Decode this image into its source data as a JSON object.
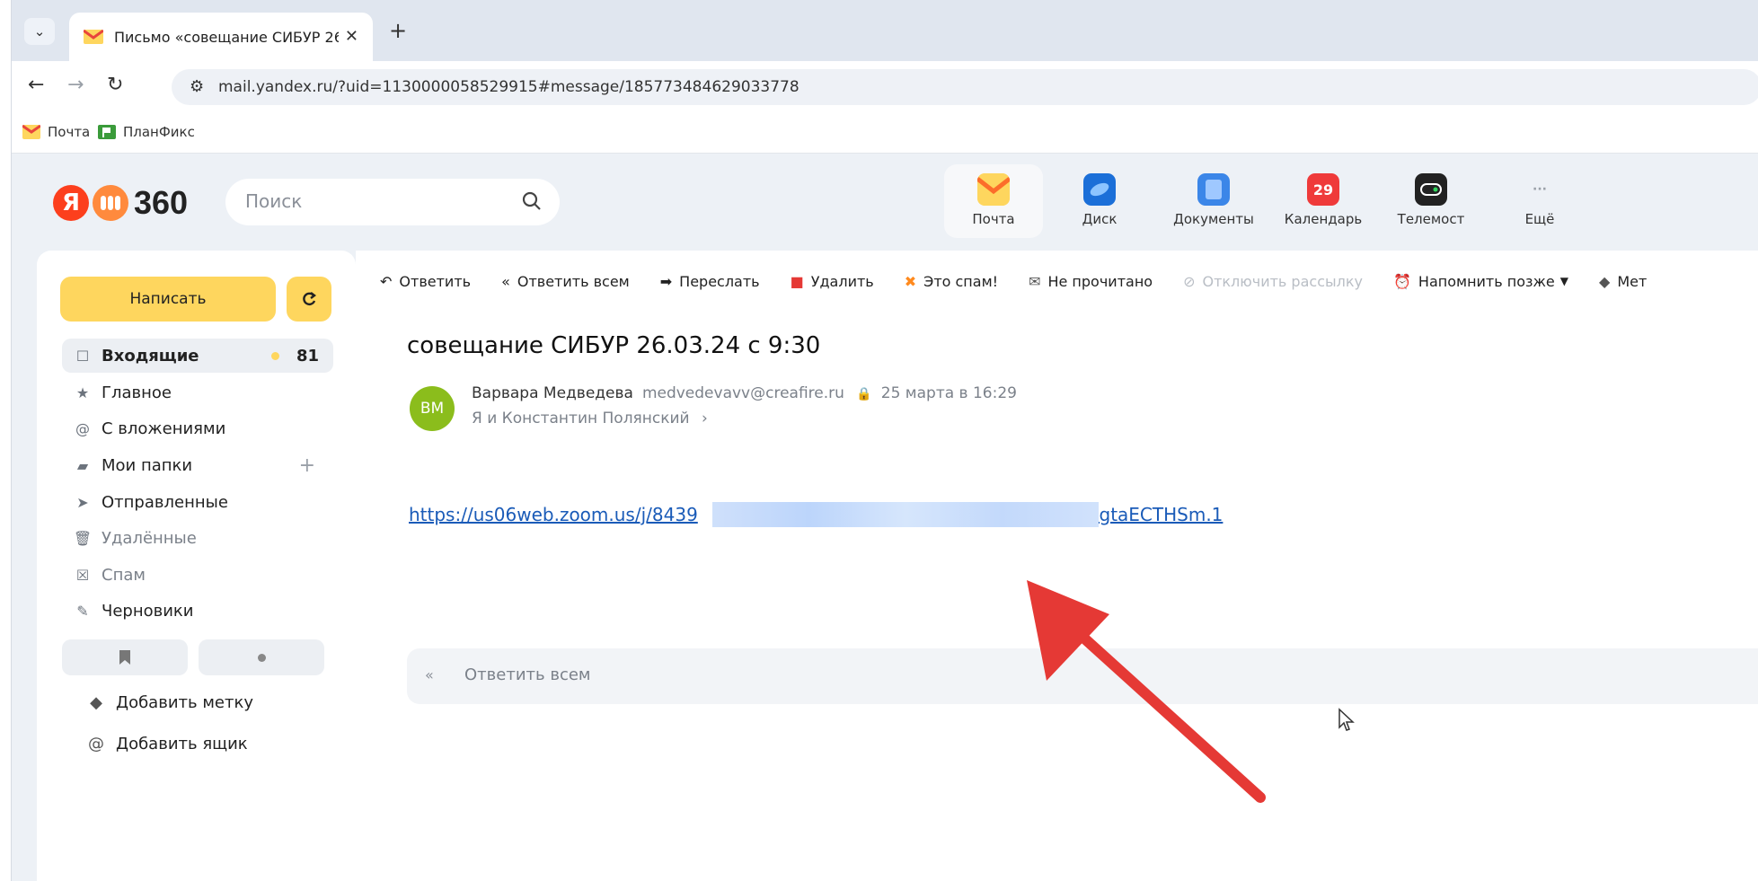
{
  "browser": {
    "tab_title": "Письмо «совещание СИБУР 26",
    "url": "mail.yandex.ru/?uid=1130000058529915#message/185773484629033778",
    "bookmarks": [
      {
        "label": "Почта"
      },
      {
        "label": "ПланФикс"
      }
    ]
  },
  "header": {
    "logo_ya": "Я",
    "logo_num": "360",
    "search_placeholder": "Поиск",
    "apps": [
      {
        "label": "Почта",
        "icon": "mail-app-icon",
        "color": "#fed65e"
      },
      {
        "label": "Диск",
        "icon": "disk-app-icon",
        "color": "#1b6fd8"
      },
      {
        "label": "Документы",
        "icon": "docs-app-icon",
        "color": "#3b86e8"
      },
      {
        "label": "Календарь",
        "icon": "calendar-app-icon",
        "badge": "29",
        "color": "#ef3a3a"
      },
      {
        "label": "Телемост",
        "icon": "telemost-app-icon",
        "color": "#222222"
      },
      {
        "label": "Ещё",
        "icon": "more-app-icon"
      }
    ]
  },
  "sidebar": {
    "compose_label": "Написать",
    "folders": [
      {
        "label": "Входящие",
        "count": "81",
        "icon": "inbox-icon"
      },
      {
        "label": "Главное",
        "icon": "star-icon"
      },
      {
        "label": "С вложениями",
        "icon": "paperclip-icon"
      },
      {
        "label": "Мои папки",
        "icon": "folders-icon"
      },
      {
        "label": "Отправленные",
        "icon": "send-icon"
      },
      {
        "label": "Удалённые",
        "icon": "trash-icon"
      },
      {
        "label": "Спам",
        "icon": "spam-icon"
      },
      {
        "label": "Черновики",
        "icon": "drafts-icon"
      }
    ],
    "add_label": "Добавить метку",
    "add_mailbox": "Добавить ящик"
  },
  "toolbar": {
    "reply": "Ответить",
    "reply_all": "Ответить всем",
    "forward": "Переслать",
    "delete": "Удалить",
    "spam": "Это спам!",
    "unread": "Не прочитано",
    "unsubscribe": "Отключить рассылку",
    "remind": "Напомнить позже",
    "label": "Мет"
  },
  "message": {
    "subject": "совещание СИБУР 26.03.24 с 9:30",
    "avatar_initials": "ВМ",
    "sender_name": "Варвара Медведева",
    "sender_email": "medvedevavv@creafire.ru",
    "date": "25 марта в 16:29",
    "recipients": "Я и Константин Полянский",
    "link_start": "https://us06web.zoom.us/j/8439",
    "link_end": "bgtaECTHSm.1",
    "quick_reply": "Ответить всем"
  },
  "colors": {
    "accent_yellow": "#fed65e",
    "link_blue": "#1a5bb8",
    "arrow_red": "#e53935"
  }
}
